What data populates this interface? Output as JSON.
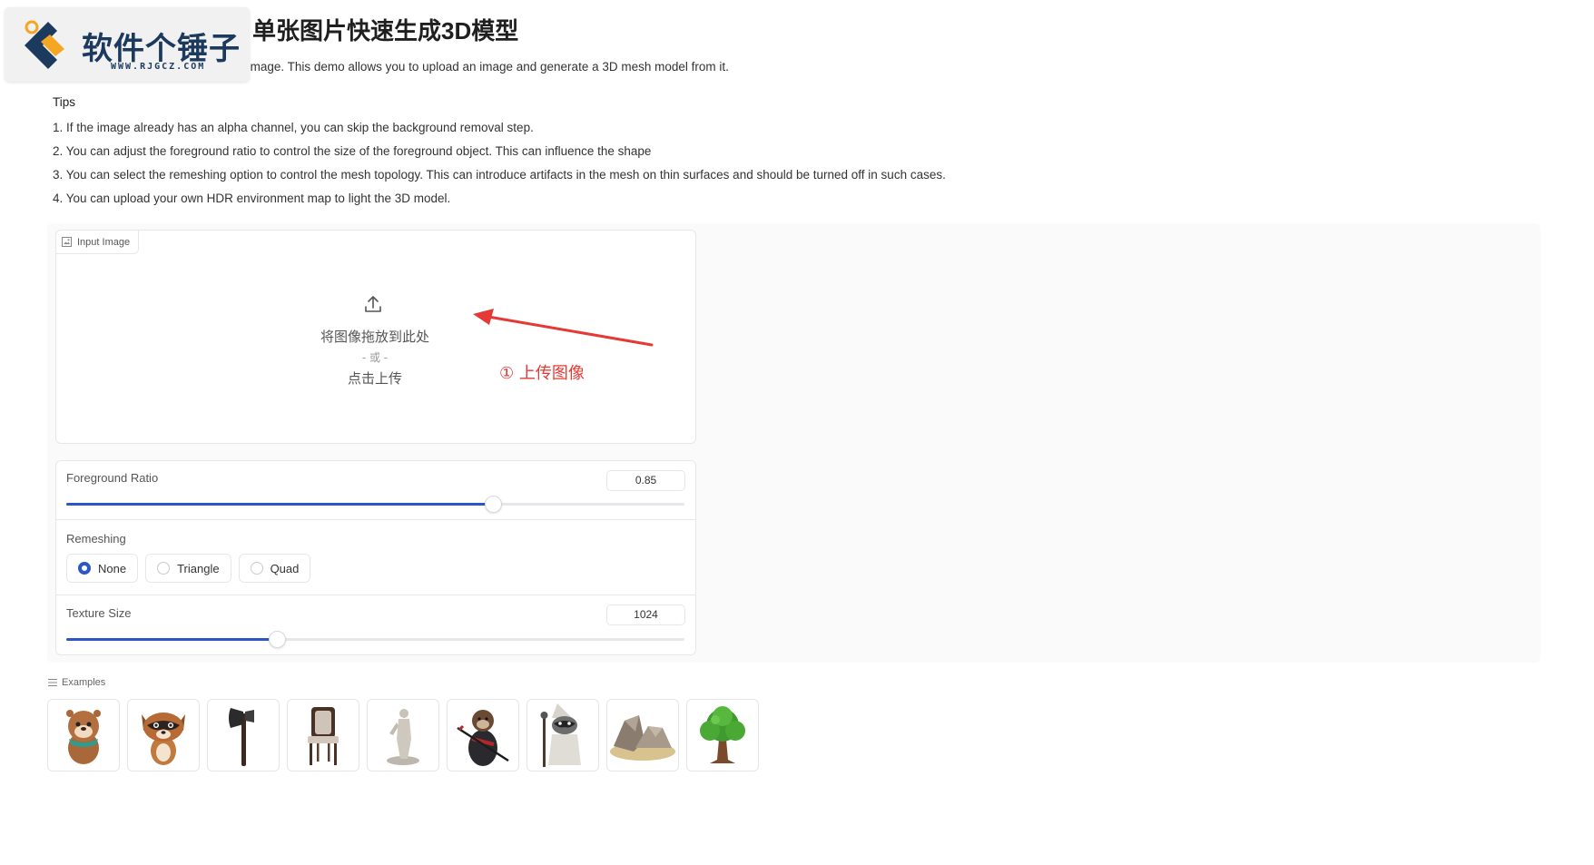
{
  "watermark": {
    "name": "软件个锤子",
    "url": "WWW.RJGCZ.COM"
  },
  "header": {
    "title": "单张图片快速生成3D模型",
    "intro": ") mesh reconstruction from a single image. This demo allows you to upload an image and generate a 3D mesh model from it."
  },
  "tips": {
    "title": "Tips",
    "items": [
      "1. If the image already has an alpha channel, you can skip the background removal step.",
      "2. You can adjust the foreground ratio to control the size of the foreground object. This can influence the shape",
      "3. You can select the remeshing option to control the mesh topology. This can introduce artifacts in the mesh on thin surfaces and should be turned off in such cases.",
      "4. You can upload your own HDR environment map to light the 3D model."
    ]
  },
  "upload": {
    "label": "Input Image",
    "drop_text": "将图像拖放到此处",
    "or_text": "- 或 -",
    "click_text": "点击上传",
    "annotation": "① 上传图像"
  },
  "controls": {
    "foreground_ratio": {
      "label": "Foreground Ratio",
      "value": "0.85",
      "fill_fraction": 0.69
    },
    "remeshing": {
      "label": "Remeshing",
      "options": [
        "None",
        "Triangle",
        "Quad"
      ],
      "selected": "None"
    },
    "texture_size": {
      "label": "Texture Size",
      "value": "1024",
      "fill_fraction": 0.34
    }
  },
  "examples": {
    "label": "Examples",
    "items": [
      "otter",
      "raccoon",
      "axe",
      "chair",
      "statue",
      "samurai-otter",
      "raccoon-wizard",
      "rocks",
      "tree"
    ]
  },
  "colors": {
    "accent": "#2b56c7",
    "annotation": "#e53935",
    "logo": "#1b3a5e"
  }
}
